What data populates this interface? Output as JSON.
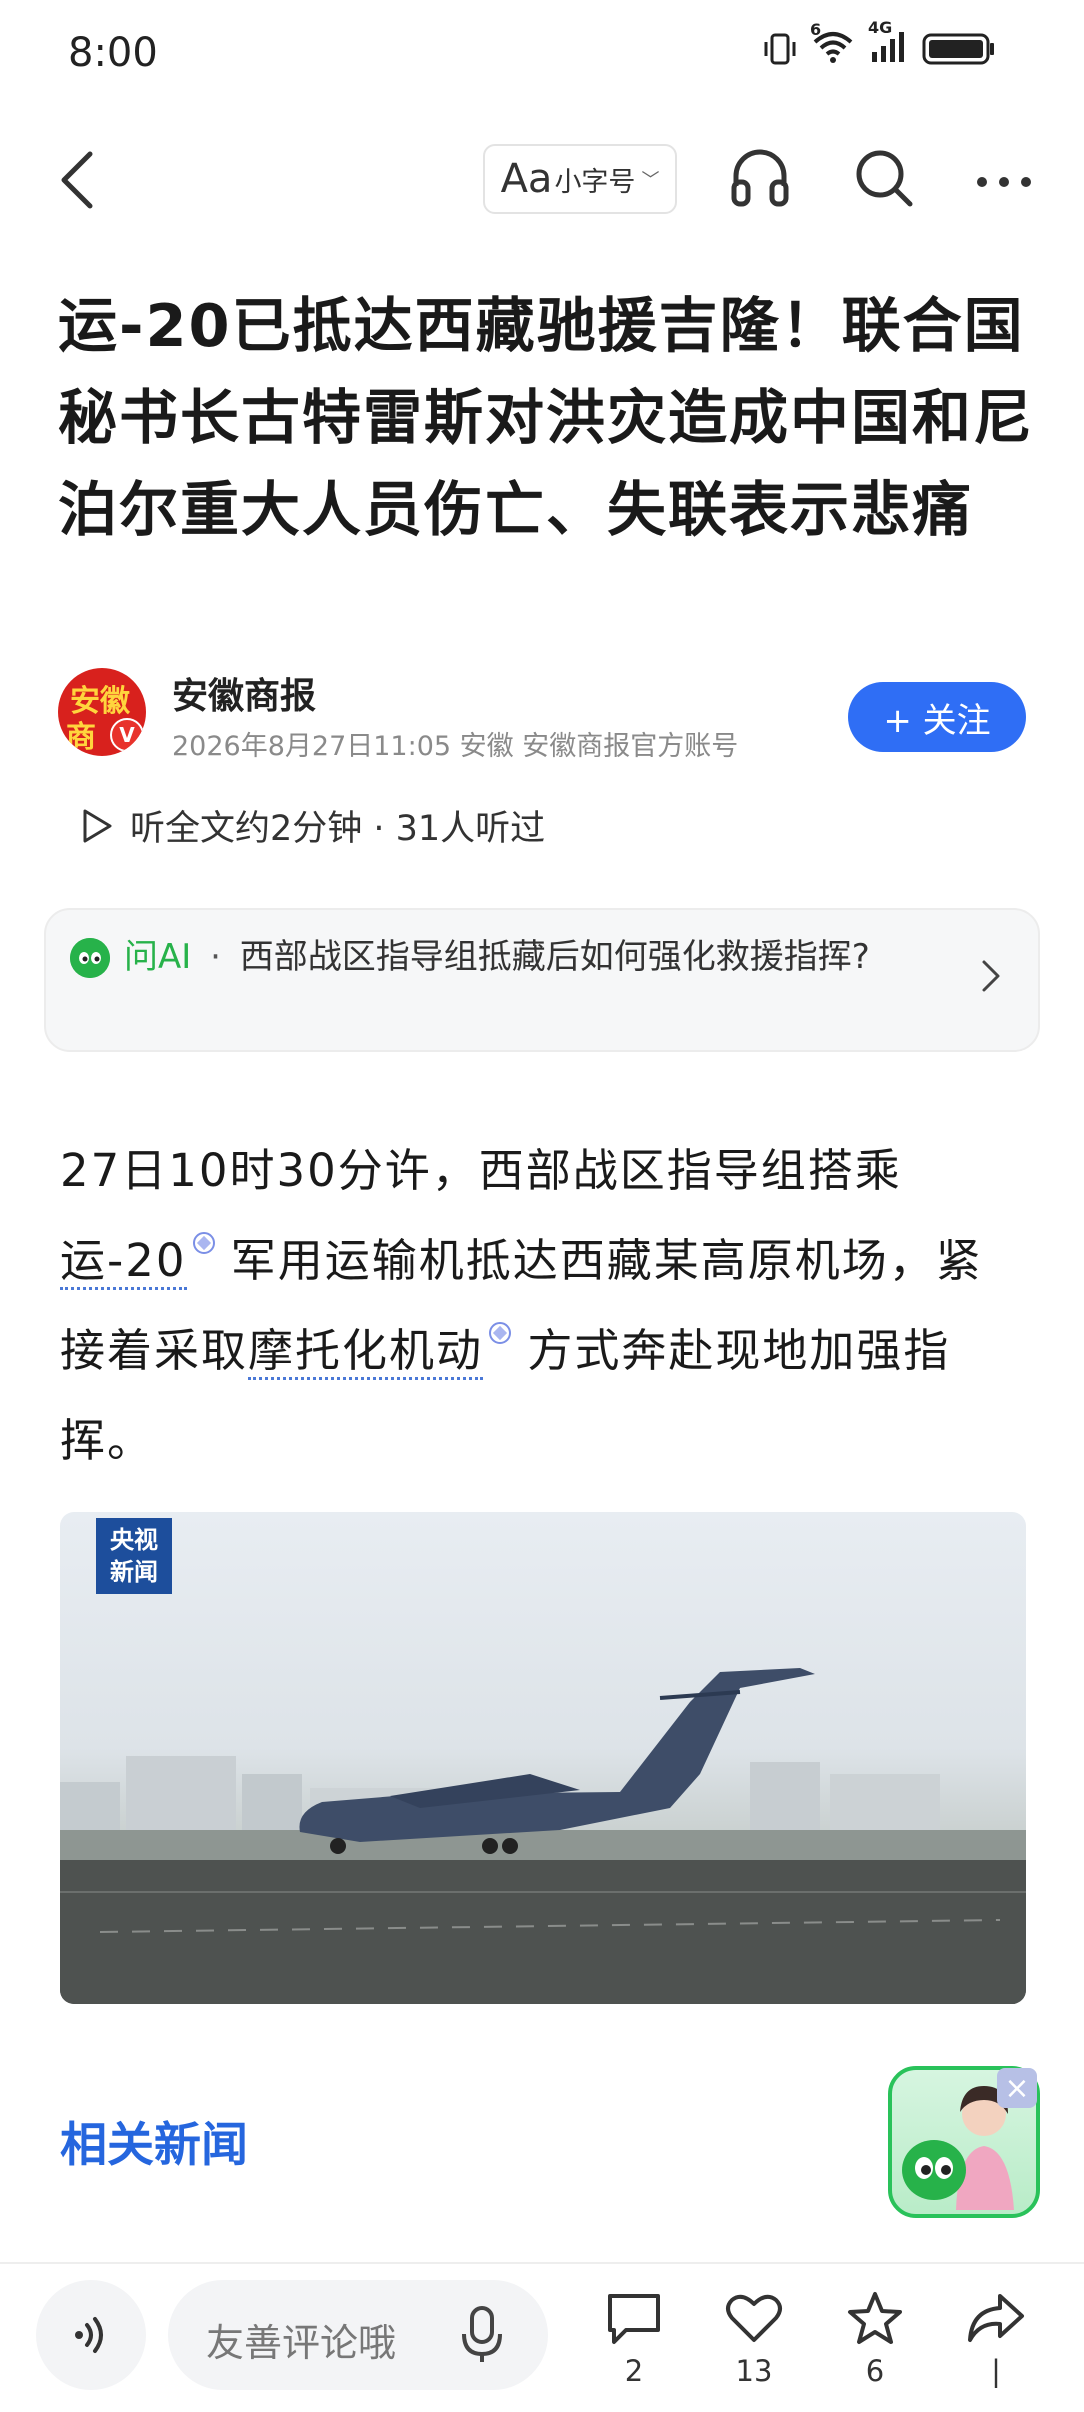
{
  "status_bar": {
    "time": "8:00",
    "icons": [
      "vibrate-icon",
      "wifi-icon",
      "signal-icon",
      "battery-icon"
    ],
    "wifi_label": "6",
    "network_label": "4G"
  },
  "toolbar": {
    "font_button_aa": "Aa",
    "font_button_label": "小字号",
    "icons": [
      "back-icon",
      "headphones-icon",
      "search-icon",
      "more-icon"
    ]
  },
  "article": {
    "title": "运-20已抵达西藏驰援吉隆！联合国秘书长古特雷斯对洪灾造成中国和尼泊尔重大人员伤亡、失联表示悲痛",
    "author": {
      "name": "安徽商报",
      "avatar_text_top": "安徽",
      "avatar_text_bottom": "商",
      "verified_mark": "V",
      "meta": "2026年8月27日11:05 安徽 安徽商报官方账号",
      "follow_label": "+ 关注"
    },
    "listen": {
      "text": "听全文约2分钟 · 31人听过"
    },
    "ask_ai": {
      "label": "问AI",
      "separator": "·",
      "question": "西部战区指导组抵藏后如何强化救援指挥?"
    },
    "body": {
      "part1": "27日10时30分许，西部战区指导组搭乘",
      "keyword1": "运-20",
      "part2": " 军用运输机抵达西藏某高原机场，紧接着采取",
      "keyword2": "摩托化机动",
      "part3": " 方式奔赴现地加强指挥。"
    },
    "image_badge": {
      "line1": "央视",
      "line2": "新闻"
    },
    "related_title": "相关新闻"
  },
  "colors": {
    "accent_blue": "#2f6ef5",
    "related_blue": "#2566de",
    "ai_green": "#27b24a",
    "avatar_red": "#d8211d"
  },
  "bottom_bar": {
    "comment_placeholder": "友善评论哦",
    "comment_count": "2",
    "like_count": "13",
    "favorite_count": "6",
    "share_count": "|"
  }
}
